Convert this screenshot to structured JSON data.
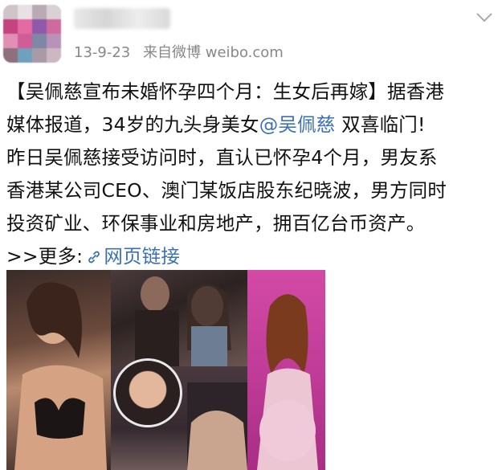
{
  "post": {
    "timestamp": "13-9-23",
    "source": "来自微博 weibo.com",
    "lines": [
      "【吴佩慈宣布未婚怀孕四个月：生女后再嫁】据香港",
      "媒体报道，34岁的九头身美女",
      "昨日吴佩慈接受访问时，直认已怀孕4个月，男友系",
      "香港某公司CEO、澳门某饭店股东纪晓波，男方同时",
      "投资矿业、环保事业和房地产，拥百亿台币资产。"
    ],
    "mention": "@吴佩慈",
    "line2_tail": " 双喜临门!",
    "more_prefix": ">>更多:",
    "more_link": "网页链接"
  },
  "icons": {
    "menu": "chevron-down-icon",
    "link": "link-icon"
  },
  "colors": {
    "link": "#3b6fb6",
    "meta": "#888888"
  }
}
